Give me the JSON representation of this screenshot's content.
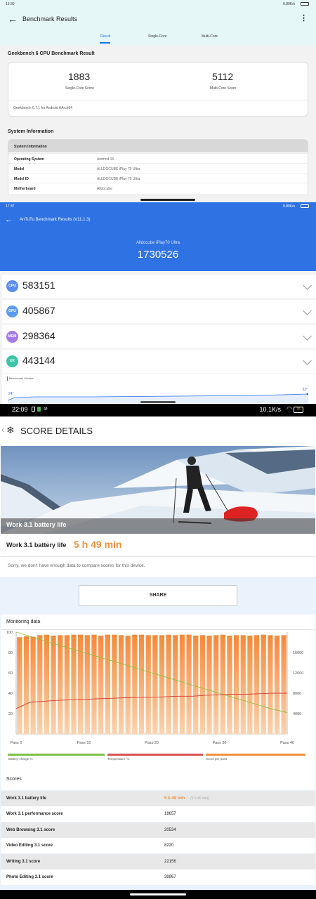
{
  "geekbench": {
    "status_time": "13:30",
    "status_speed": "0.89K/s",
    "title": "Benchmark Results",
    "tabs": [
      "Result",
      "Single-Core",
      "Multi-Core"
    ],
    "section_title": "Geekbench 6 CPU Benchmark Result",
    "single_score": "1883",
    "single_label": "Single-Core Score",
    "multi_score": "5112",
    "multi_label": "Multi-Core Score",
    "version": "Geekbench 6.7.1 for Android AArch64",
    "sysinfo_title": "System Information",
    "sysinfo_header": "System Information",
    "sysinfo_rows": [
      {
        "k": "Operating System",
        "v": "Android 15"
      },
      {
        "k": "Model",
        "v": "ALLDOCUBE iPlay 70 Ultra"
      },
      {
        "k": "Model ID",
        "v": "ALLDOCUBE iPlay 70 Ultra"
      },
      {
        "k": "Motherboard",
        "v": "Alldocube"
      }
    ]
  },
  "antutu": {
    "status_time": "17:37",
    "status_speed": "0.89K/s",
    "title": "AnTuTu Benchmark Results (V11.1.3)",
    "device": "Alldocube iPlay70 Ultra",
    "total": "1730526",
    "rows": [
      {
        "icon": "CPU",
        "score": "583151",
        "color": "#5b8def"
      },
      {
        "icon": "GPU",
        "score": "405867",
        "color": "#5b9cf0"
      },
      {
        "icon": "MEM",
        "score": "298364",
        "color": "#a57be8"
      },
      {
        "icon": "UX",
        "score": "443144",
        "color": "#3cc3a8"
      }
    ],
    "monitor_label": "Benchmark Monitor",
    "temp_start": "24°",
    "temp_end": "33°"
  },
  "pcmark": {
    "status_time": "22:09",
    "status_speed": "10.1K/s",
    "battery": "76",
    "header_title": "SCORE DETAILS",
    "hero_caption": "Work 3.1 battery life",
    "result_label": "Work 3.1 battery life",
    "result_value": "5 h 49 min",
    "compare_note": "Sorry, we don't have enough data to compare scores for this device.",
    "share_label": "SHARE",
    "monitoring_title": "Monitoring data",
    "legend": [
      {
        "label": "Battery charge %",
        "color": "#7cc242"
      },
      {
        "label": "Temperature °C",
        "color": "#d9534f"
      },
      {
        "label": "Score per pass",
        "color": "#f0913a"
      }
    ],
    "scores_title": "Scores",
    "score_rows": [
      {
        "name": "Work 3.1 battery life",
        "value": "5 h 49 min",
        "sub": "(5 h 49 min)"
      },
      {
        "name": "Work 3.1 performance score",
        "value": "18657",
        "sub": ""
      },
      {
        "name": "Web Browsing 3.1 score",
        "value": "20534",
        "sub": ""
      },
      {
        "name": "Video Editing 3.1 score",
        "value": "8220",
        "sub": ""
      },
      {
        "name": "Writing 3.1 score",
        "value": "22156",
        "sub": ""
      },
      {
        "name": "Photo Editing 3.1 score",
        "value": "39967",
        "sub": ""
      }
    ]
  },
  "chart_data": {
    "type": "bar",
    "x_ticks": [
      "Pass 0",
      "Pass 10",
      "Pass 20",
      "Pass 30",
      "Pass 40"
    ],
    "y_left_ticks": [
      "100",
      "80",
      "60",
      "40",
      "20"
    ],
    "y_right_ticks": [
      "16000",
      "12000",
      "8000",
      "4000"
    ],
    "ylim_left": [
      0,
      100
    ],
    "ylim_right": [
      0,
      20000
    ],
    "series": [
      {
        "name": "Score per pass",
        "axis": "right",
        "values": [
          19000,
          19200,
          19100,
          19400,
          19500,
          19300,
          19400,
          19400,
          19500,
          19500,
          19400,
          19500,
          19300,
          19500,
          19500,
          19400,
          19300,
          19500,
          19500,
          19400,
          19400,
          19400,
          19500,
          19400,
          19500,
          19500,
          19300,
          19400,
          19300,
          19400,
          19500,
          19300,
          19400,
          19400,
          19300,
          19400,
          19500,
          19400,
          19300,
          19400
        ]
      },
      {
        "name": "Battery charge %",
        "axis": "left",
        "values": [
          100,
          95,
          90,
          85,
          80,
          75,
          70,
          65,
          60,
          55,
          50,
          45,
          40,
          35,
          30,
          25,
          21
        ]
      },
      {
        "name": "Temperature °C",
        "axis": "left",
        "values": [
          25,
          31,
          32,
          33,
          33.5,
          34,
          34.5,
          35,
          35.5,
          36,
          36,
          36.5,
          37,
          37,
          38,
          38.5,
          39,
          39,
          39.5,
          40,
          40
        ]
      }
    ]
  }
}
